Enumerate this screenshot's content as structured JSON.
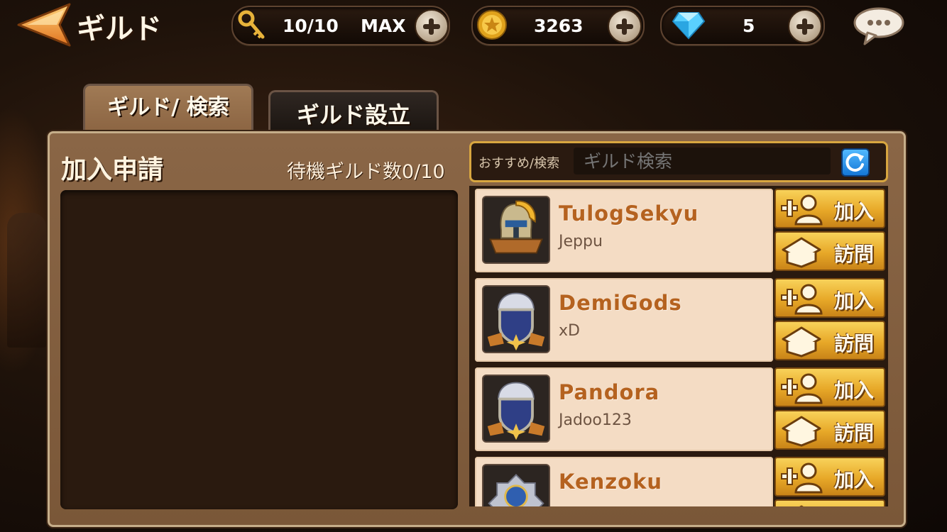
{
  "header": {
    "title": "ギルド",
    "keys": "10/10",
    "keys_max": "MAX",
    "gold": "3263",
    "gems": "5"
  },
  "tabs": [
    {
      "label": "ギルド/ 検索",
      "active": true
    },
    {
      "label": "ギルド設立",
      "active": false
    }
  ],
  "apply": {
    "title": "加入申請",
    "waiting": "待機ギルド数0/10"
  },
  "search": {
    "label": "おすすめ/検索",
    "placeholder": "ギルド検索"
  },
  "buttons": {
    "join": "加入",
    "visit": "訪問"
  },
  "guilds": [
    {
      "name": "TulogSekyu",
      "leader": "Jeppu",
      "emblem": "spartan-helmet-emblem"
    },
    {
      "name": "DemiGods",
      "leader": "xD",
      "emblem": "silver-shield-emblem"
    },
    {
      "name": "Pandora",
      "leader": "Jadoo123",
      "emblem": "silver-shield-emblem"
    },
    {
      "name": "Kenzoku",
      "leader": "",
      "emblem": "blue-crest-emblem"
    }
  ],
  "colors": {
    "accent_gold": "#e7a828",
    "guild_name": "#b5621f",
    "panel": "#8a6646",
    "search_border": "#d8a640"
  }
}
